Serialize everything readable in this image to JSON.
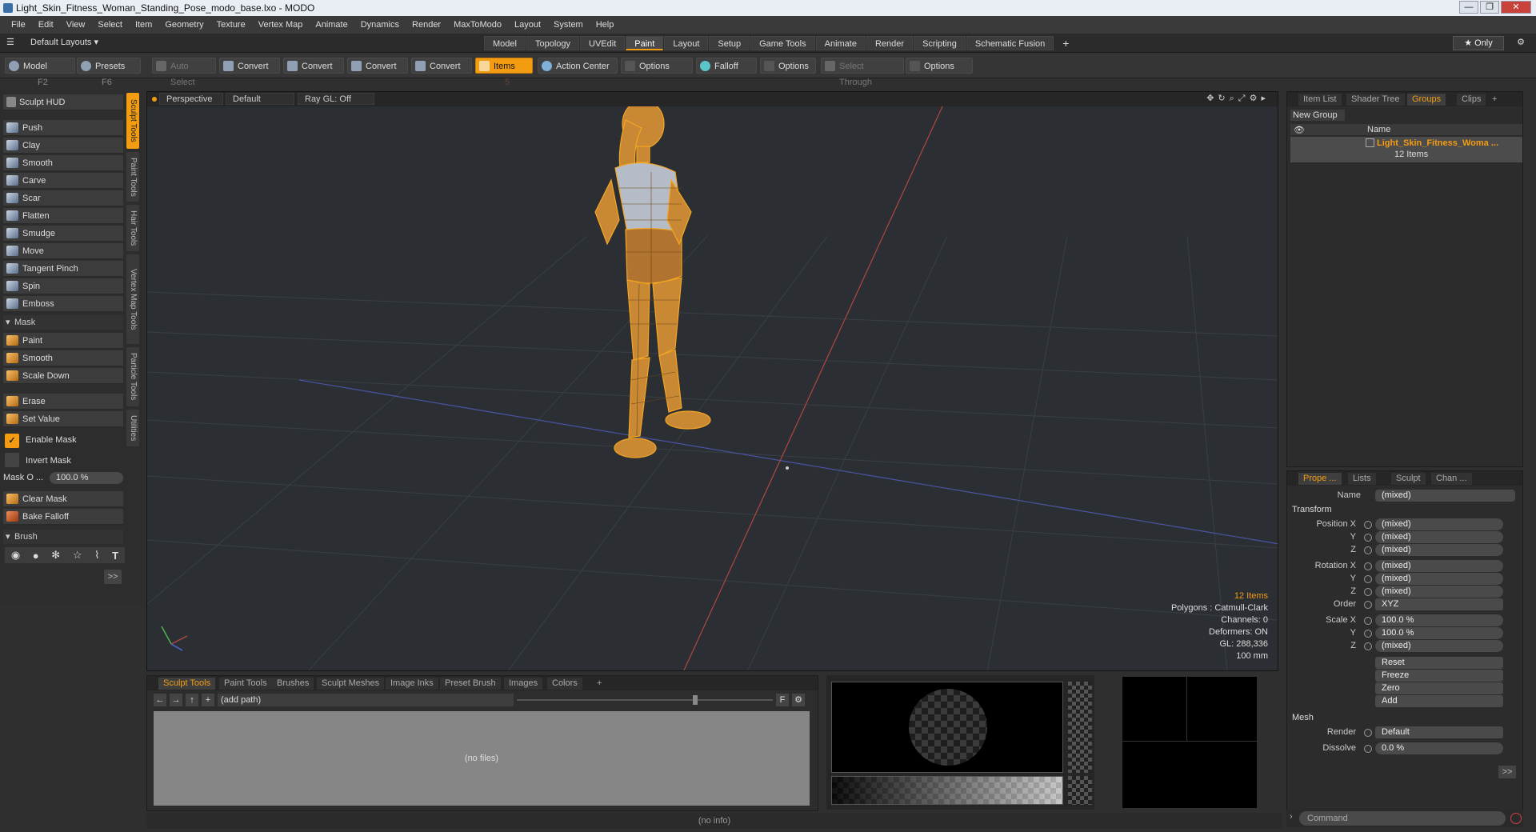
{
  "window": {
    "title": "Light_Skin_Fitness_Woman_Standing_Pose_modo_base.lxo - MODO",
    "buttons": [
      "—",
      "❐",
      "✕"
    ]
  },
  "menu": [
    "File",
    "Edit",
    "View",
    "Select",
    "Item",
    "Geometry",
    "Texture",
    "Vertex Map",
    "Animate",
    "Dynamics",
    "Render",
    "MaxToModo",
    "Layout",
    "System",
    "Help"
  ],
  "layout_tabs": {
    "layouts_label": "Default Layouts ▾",
    "tabs": [
      "Model",
      "Topology",
      "UVEdit",
      "Paint",
      "Layout",
      "Setup",
      "Game Tools",
      "Animate",
      "Render",
      "Scripting",
      "Schematic Fusion"
    ],
    "active": "Paint",
    "add": "+",
    "only": "★ Only"
  },
  "toolbar": {
    "model": "Model",
    "model_key": "F2",
    "presets": "Presets",
    "presets_key": "F6",
    "auto_select": "Auto Select",
    "convert1": "Convert",
    "convert2": "Convert",
    "convert3": "Convert",
    "convert4": "Convert",
    "items": "Items",
    "items_key": "5",
    "action_center": "Action Center",
    "options1": "Options",
    "falloff": "Falloff",
    "options2": "Options",
    "select_through": "Select Through",
    "options3": "Options"
  },
  "left": {
    "sculpt_hud": "Sculpt HUD",
    "tools": [
      "Push",
      "Clay",
      "Smooth",
      "Carve",
      "Scar",
      "Flatten",
      "Smudge",
      "Move",
      "Tangent Pinch",
      "Spin",
      "Emboss"
    ],
    "mask_header": "Mask",
    "mask_tools": [
      "Paint",
      "Smooth",
      "Scale Down"
    ],
    "erase": "Erase",
    "set_value": "Set Value",
    "enable_mask": "Enable Mask",
    "invert_mask": "Invert Mask",
    "mask_opacity_label": "Mask O ...",
    "mask_opacity_value": "100.0 %",
    "clear_mask": "Clear Mask",
    "bake_falloff": "Bake Falloff",
    "brush_header": "Brush",
    "more": ">>"
  },
  "side_tabs": [
    "Sculpt Tools",
    "Paint Tools",
    "Hair Tools",
    "Vertex Map Tools",
    "Particle Tools",
    "Utilities"
  ],
  "viewport": {
    "view": "Perspective",
    "shading": "Default",
    "raygl": "Ray GL: Off",
    "stats": {
      "items": "12 Items",
      "polygons": "Polygons : Catmull-Clark",
      "channels": "Channels: 0",
      "deformers": "Deformers: ON",
      "gl": "GL: 288,336",
      "scale": "100 mm"
    }
  },
  "groups_panel": {
    "tabs": [
      "Item List",
      "Shader Tree",
      "Groups",
      "Clips"
    ],
    "active": "Groups",
    "new_group": "New Group",
    "col_name": "Name",
    "group_name": "Light_Skin_Fitness_Woma ...",
    "group_count": "12 Items"
  },
  "props": {
    "tabs": [
      "Prope ...",
      "Lists",
      "Sculpt",
      "Chan ..."
    ],
    "name_label": "Name",
    "name_value": "(mixed)",
    "transform": "Transform",
    "pos_x": "Position X",
    "pos_y": "Y",
    "pos_z": "Z",
    "rot_x": "Rotation X",
    "rot_y": "Y",
    "rot_z": "Z",
    "order": "Order",
    "scale_x": "Scale X",
    "scale_y": "Y",
    "scale_z": "Z",
    "mixed": "(mixed)",
    "order_value": "XYZ",
    "scale_val": "100.0 %",
    "reset": "Reset",
    "freeze": "Freeze",
    "zero": "Zero",
    "add": "Add",
    "mesh": "Mesh",
    "render": "Render",
    "render_value": "Default",
    "dissolve": "Dissolve",
    "dissolve_value": "0.0 %",
    "more": ">>"
  },
  "bottom": {
    "tabs": [
      "Sculpt Tools",
      "Paint Tools",
      "Brushes",
      "Sculpt Meshes",
      "Image Inks",
      "Preset Brush",
      "Images",
      "Colors"
    ],
    "active": "Sculpt Tools",
    "path": "(add path)",
    "no_files": "(no files)",
    "flag": "F"
  },
  "command": {
    "placeholder": "Command"
  },
  "status": {
    "info": "(no info)"
  },
  "colors": {
    "accent": "#f39c12",
    "bg": "#2f2f2f"
  }
}
